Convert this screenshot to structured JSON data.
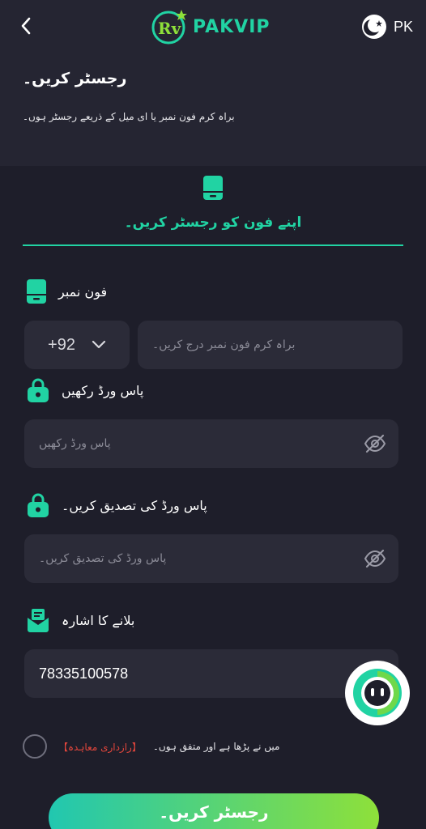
{
  "header": {
    "logo_text": "PAKVIP",
    "region_label": "PK"
  },
  "intro": {
    "title": "رجسٹر کریں۔",
    "subtitle": "براہ کرم فون نمبر یا ای میل کے ذریعے رجسٹر ہوں۔"
  },
  "tab": {
    "label": "اپنے فون کو رجسٹر کریں۔"
  },
  "phone": {
    "label": "فون نمبر",
    "country_code": "+92",
    "placeholder": "براہ کرم فون نمبر درج کریں۔"
  },
  "password": {
    "label": "پاس ورڈ رکھیں",
    "placeholder": "پاس ورڈ رکھیں"
  },
  "confirm_password": {
    "label": "پاس ورڈ کی تصدیق کریں۔",
    "placeholder": "پاس ورڈ کی تصدیق کریں۔"
  },
  "invite": {
    "label": "بلانے کا اشارہ",
    "value": "78335100578"
  },
  "agreement": {
    "text": "میں نے پڑھا ہے اور متفق ہوں۔",
    "link": "【رازداری معاہدہ】"
  },
  "register_button": {
    "label": "رجسٹر کریں۔"
  },
  "colors": {
    "accent": "#21d3a3",
    "background": "#1e1e2a",
    "field": "#2b2b38",
    "link": "#e2463c"
  }
}
